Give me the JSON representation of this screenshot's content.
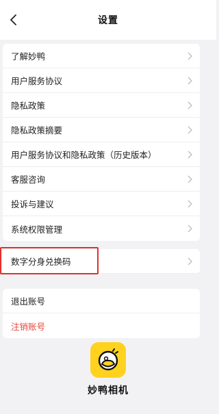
{
  "header": {
    "title": "设置",
    "back_icon": "chevron-left-icon"
  },
  "section1": {
    "items": [
      {
        "label": "了解妙鸭"
      },
      {
        "label": "用户服务协议"
      },
      {
        "label": "隐私政策"
      },
      {
        "label": "隐私政策摘要"
      },
      {
        "label": "用户服务协议和隐私政策（历史版本）"
      },
      {
        "label": "客服咨询"
      },
      {
        "label": "投诉与建议"
      },
      {
        "label": "系统权限管理"
      }
    ]
  },
  "section2": {
    "items": [
      {
        "label": "数字分身兑换码"
      }
    ]
  },
  "section3": {
    "logout_label": "退出账号",
    "deactivate_label": "注销账号"
  },
  "footer": {
    "app_name": "妙鸭相机"
  },
  "colors": {
    "background": "#f2f2f4",
    "danger": "#e5483b",
    "logo": "#ffd21f",
    "highlight_box": "#e0302a"
  }
}
